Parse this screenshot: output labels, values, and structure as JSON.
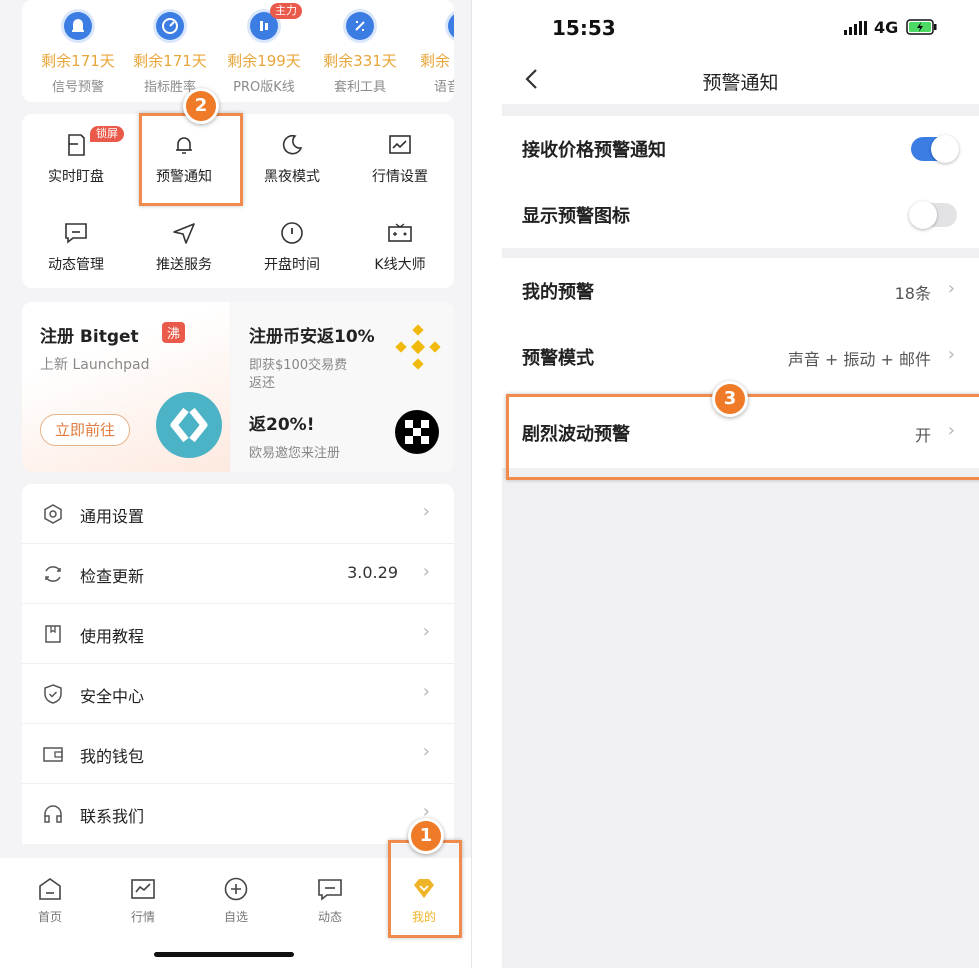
{
  "left": {
    "subscriptions": [
      {
        "days": "剩余171天",
        "name": "信号预警",
        "icon": "alarm-icon"
      },
      {
        "days": "剩余171天",
        "name": "指标胜率",
        "icon": "target-icon"
      },
      {
        "days": "剩余199天",
        "name": "PRO版K线",
        "icon": "pro-kline-icon",
        "tag": "主力"
      },
      {
        "days": "剩余331天",
        "name": "套利工具",
        "icon": "arbitrage-icon"
      },
      {
        "days": "剩余",
        "name": "语音",
        "icon": "voice-icon"
      }
    ],
    "grid": [
      {
        "label": "实时盯盘",
        "icon": "monitor-icon",
        "tag": "锁屏"
      },
      {
        "label": "预警通知",
        "icon": "bell-icon"
      },
      {
        "label": "黑夜模式",
        "icon": "moon-icon"
      },
      {
        "label": "行情设置",
        "icon": "chart-icon"
      },
      {
        "label": "动态管理",
        "icon": "message-icon"
      },
      {
        "label": "推送服务",
        "icon": "send-icon"
      },
      {
        "label": "开盘时间",
        "icon": "clock-icon"
      },
      {
        "label": "K线大师",
        "icon": "gamepad-icon"
      }
    ],
    "promo": {
      "bitget_title": "注册 Bitget",
      "bitget_tag": "沸",
      "bitget_sub": "上新 Launchpad",
      "bitget_button": "立即前往",
      "binance_title": "注册币安返10%",
      "binance_sub_1": "即获$100交易费",
      "binance_sub_2": "返还",
      "okx_title": "返20%!",
      "okx_sub": "欧易邀您来注册"
    },
    "menu": [
      {
        "label": "通用设置",
        "icon": "settings-icon",
        "value": ""
      },
      {
        "label": "检查更新",
        "icon": "refresh-icon",
        "value": "3.0.29"
      },
      {
        "label": "使用教程",
        "icon": "book-icon",
        "value": ""
      },
      {
        "label": "安全中心",
        "icon": "shield-icon",
        "value": ""
      },
      {
        "label": "我的钱包",
        "icon": "wallet-icon",
        "value": ""
      },
      {
        "label": "联系我们",
        "icon": "headset-icon",
        "value": ""
      }
    ],
    "tabs": [
      {
        "label": "首页",
        "icon": "home-icon"
      },
      {
        "label": "行情",
        "icon": "market-icon"
      },
      {
        "label": "自选",
        "icon": "add-circle-icon"
      },
      {
        "label": "动态",
        "icon": "feed-icon"
      },
      {
        "label": "我的",
        "icon": "diamond-icon",
        "active": true
      }
    ],
    "accent": "#e8a63a",
    "active_tab_color": "#f0b429"
  },
  "right": {
    "time": "15:53",
    "network": "4G",
    "title": "预警通知",
    "rows": [
      {
        "label": "接收价格预警通知",
        "toggle": true
      },
      {
        "label": "显示预警图标",
        "toggle": false
      },
      {
        "label": "我的预警",
        "value": "18条"
      },
      {
        "label": "预警模式",
        "value": "声音 + 振动 + 邮件"
      },
      {
        "label": "剧烈波动预警",
        "value": "开"
      }
    ],
    "toggle_on_color": "#3b7de3"
  },
  "annotations": [
    "1",
    "2",
    "3"
  ],
  "highlight_color": "#ef8b4c"
}
